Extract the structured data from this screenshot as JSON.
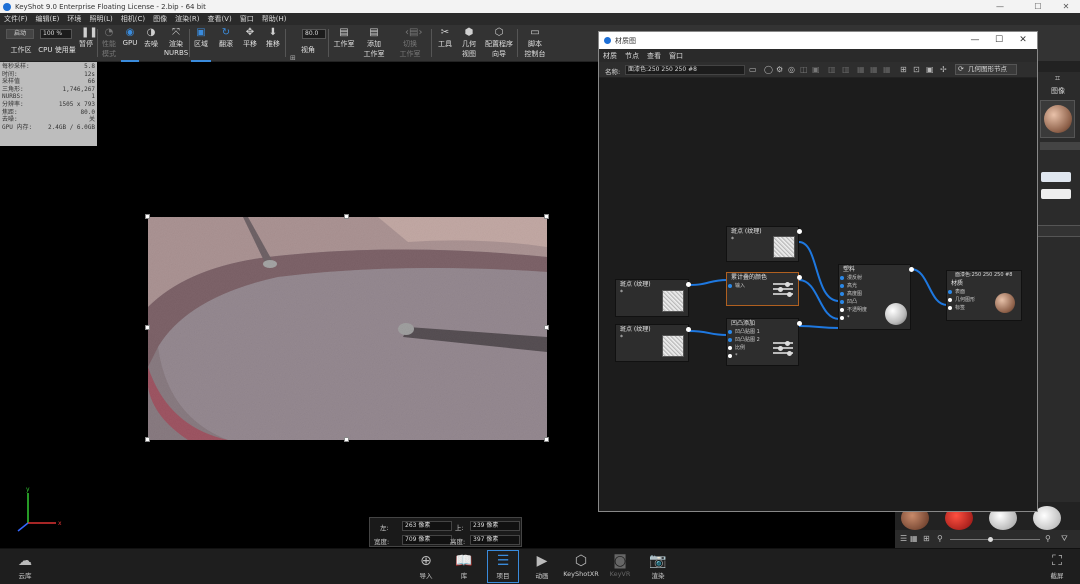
{
  "window": {
    "title": "KeyShot 9.0 Enterprise Floating License - 2.bip - 64 bit",
    "minimize": "—",
    "maximize": "☐",
    "close": "✕"
  },
  "menu": [
    "文件(F)",
    "编辑(E)",
    "环境",
    "照明(L)",
    "相机(C)",
    "图像",
    "渲染(R)",
    "查看(V)",
    "窗口",
    "帮助(H)"
  ],
  "toolbar": {
    "workspace_select": "启动",
    "zoom_value": "100 %",
    "camera_value": "80.0",
    "items": {
      "workspace": "工作区",
      "cpu_usage": "CPU 使用量",
      "pause": "暂停",
      "perf_mode": "性能\n模式",
      "gpu": "GPU",
      "denoise": "去噪",
      "render_nurbs": "渲染\nNURBS",
      "region": "区域",
      "tumble": "翻滚",
      "pan": "平移",
      "dolly": "推移",
      "view": "视角",
      "studio": "工作室",
      "add_studio": "添加\n工作室",
      "switch_studio": "切换\n工作室",
      "tools": "工具",
      "geometry_view": "几何\n视图",
      "config_wizard": "配置程序\n向导",
      "script_console": "脚本\n控制台"
    }
  },
  "stats": [
    {
      "label": "每秒采样:",
      "value": "5.8"
    },
    {
      "label": "时间:",
      "value": "12s"
    },
    {
      "label": "采样值",
      "value": "66"
    },
    {
      "label": "三角形:",
      "value": "1,746,267"
    },
    {
      "label": "NURBS:",
      "value": "1"
    },
    {
      "label": "分辨率:",
      "value": "1505 x 793"
    },
    {
      "label": "焦距:",
      "value": "80.0"
    },
    {
      "label": "去噪:",
      "value": "关"
    },
    {
      "label": "GPU 内存:",
      "value": "2.4GB / 6.0GB"
    }
  ],
  "region": {
    "left_label": "左:",
    "left_value": "263 像素",
    "top_label": "上:",
    "top_value": "239 像素",
    "width_label": "宽度:",
    "width_value": "709 像素",
    "height_label": "高度:",
    "height_value": "397 像素"
  },
  "bottombar": [
    {
      "label": "云库",
      "icon": "cloud-icon"
    },
    {
      "label": "导入",
      "icon": "import-icon"
    },
    {
      "label": "库",
      "icon": "book-icon"
    },
    {
      "label": "项目",
      "icon": "list-icon"
    },
    {
      "label": "动画",
      "icon": "play-icon"
    },
    {
      "label": "KeyShotXR",
      "icon": "cube-icon"
    },
    {
      "label": "KeyVR",
      "icon": "vr-icon"
    },
    {
      "label": "渲染",
      "icon": "camera-icon"
    },
    {
      "label": "截屏",
      "icon": "screenshot-icon"
    }
  ],
  "material_graph": {
    "title": "材质图",
    "menu": [
      "材质",
      "节点",
      "查看",
      "窗口"
    ],
    "name_label": "名称:",
    "name_value": "面漆色:250 250 250 #8",
    "geometry_node_button": "几何图形节点",
    "nodes": {
      "spots_top": {
        "title": "斑点 (纹理)",
        "port": "*"
      },
      "spots_left": {
        "title": "斑点 (纹理)",
        "port": "*"
      },
      "spots_bottom": {
        "title": "斑点 (纹理)",
        "port": "*"
      },
      "color_layer": {
        "title": "累计叠的颜色",
        "ports": [
          "输入"
        ]
      },
      "bump_add": {
        "title": "凹凸添加",
        "ports": [
          "凹凸贴图 1",
          "凹凸贴图 2",
          "比例",
          "*"
        ]
      },
      "paint": {
        "title": "塑料",
        "ports": [
          "漫反射",
          "高光",
          "高度图",
          "凹凸",
          "不透明度",
          "*"
        ]
      },
      "output": {
        "header": "面漆色:250 250 250 #8",
        "title": "材质",
        "ports": [
          "表面",
          "几何图形",
          "标签"
        ]
      }
    }
  },
  "right_panel": {
    "image_label": "图像"
  }
}
